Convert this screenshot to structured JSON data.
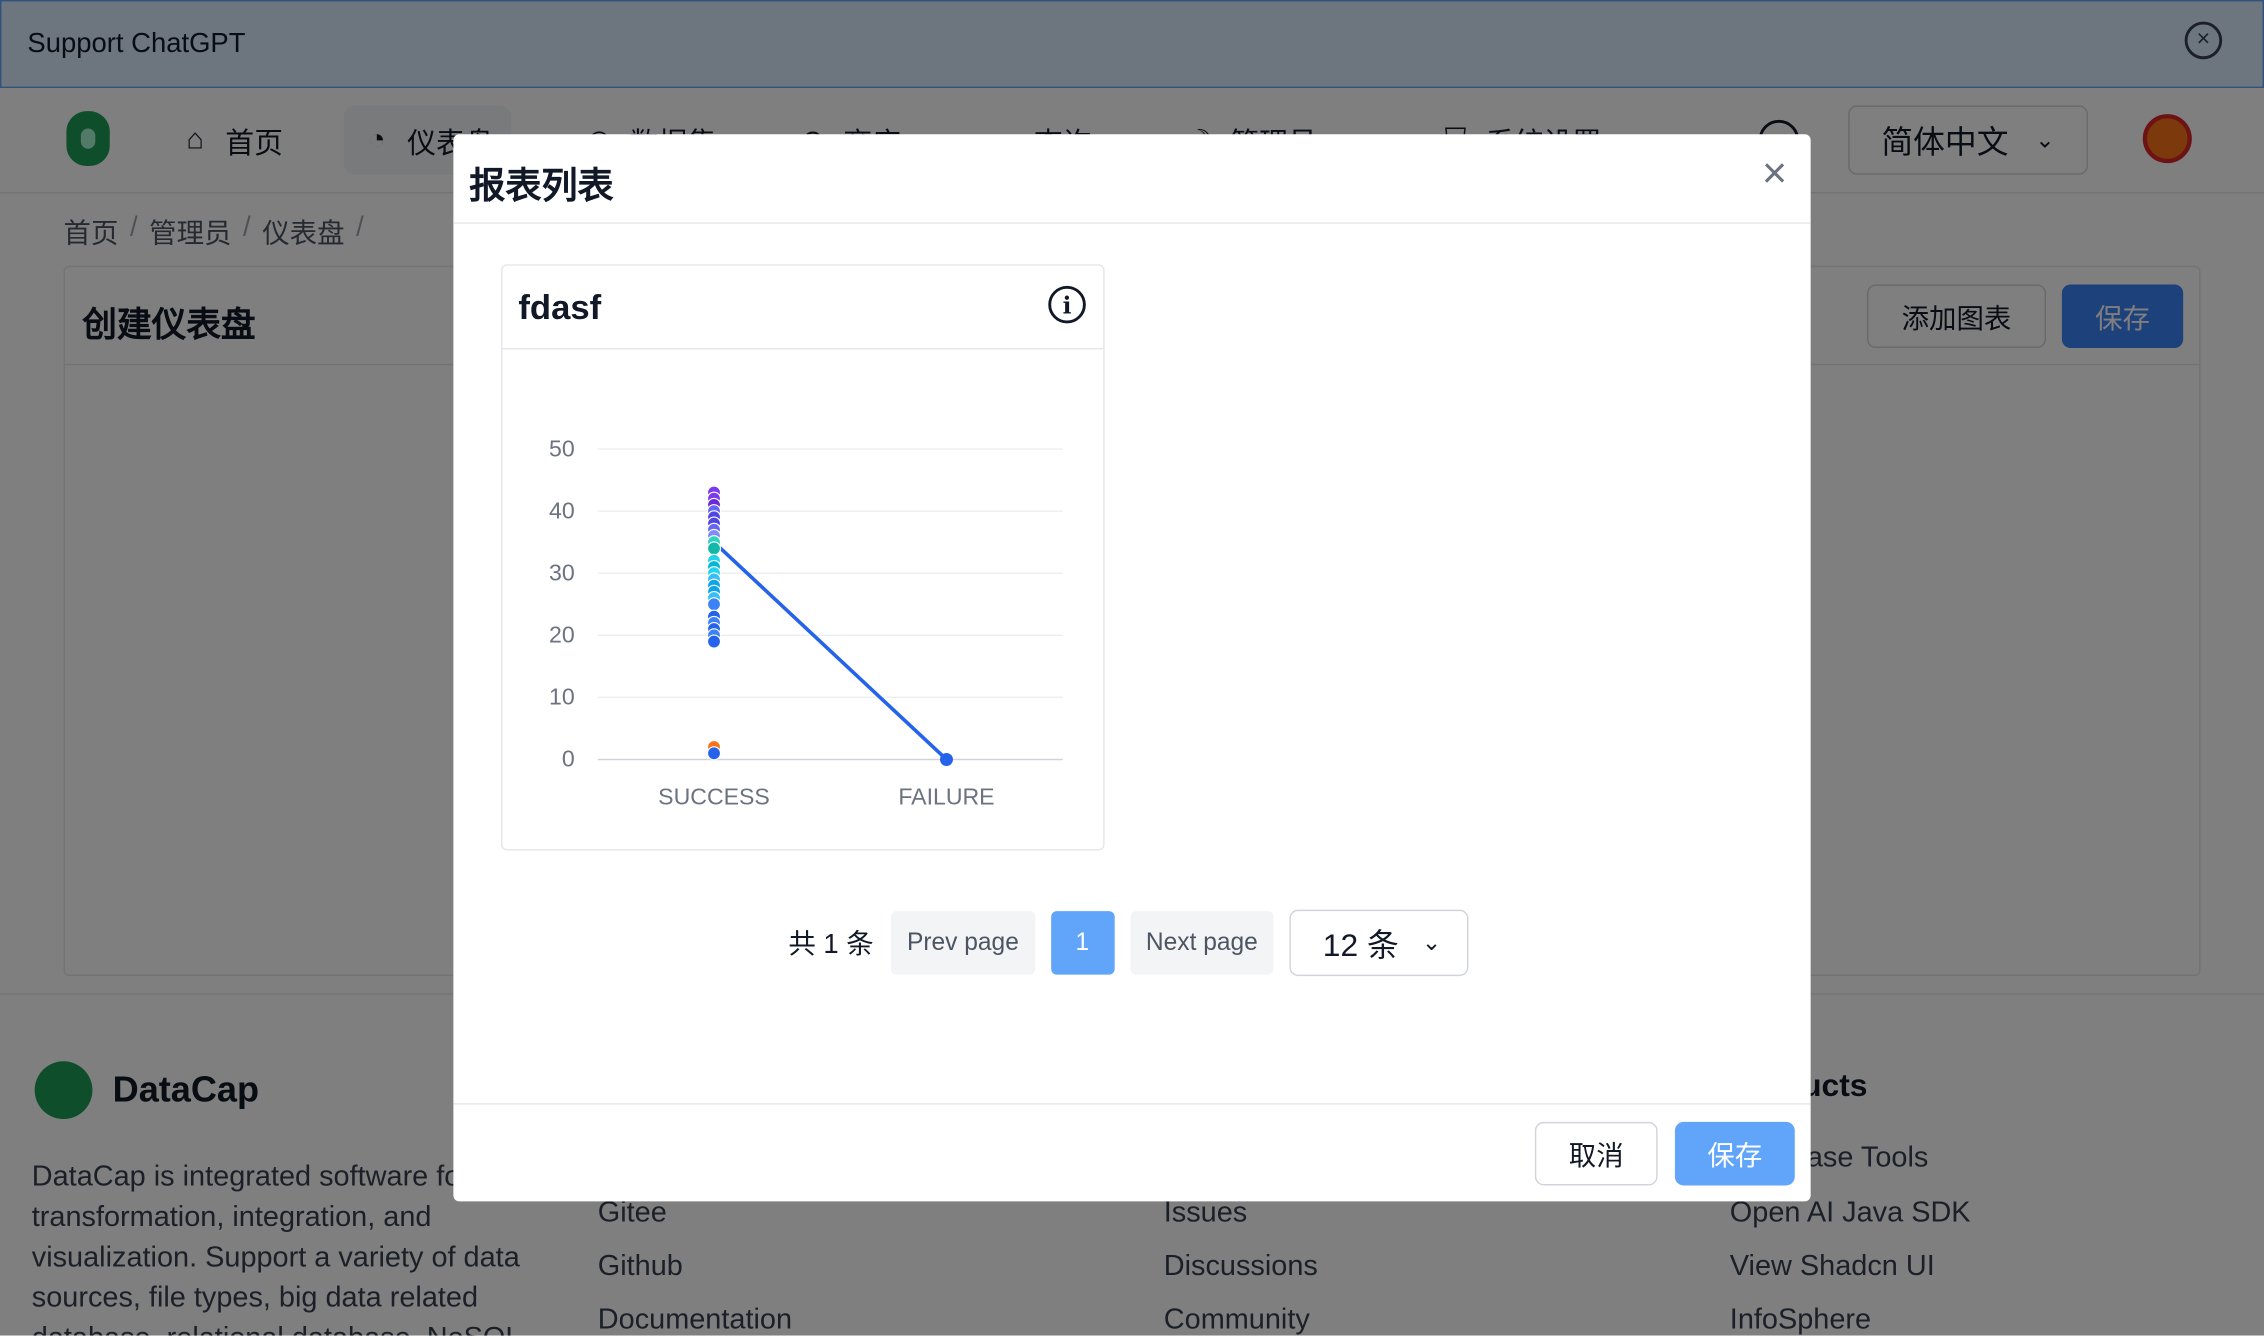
{
  "banner": {
    "text": "Support ChatGPT"
  },
  "nav": {
    "items": [
      {
        "label": "首页",
        "icon": "home-icon"
      },
      {
        "label": "仪表盘",
        "icon": "dashboard-icon"
      },
      {
        "label": "数据集",
        "icon": "dataset-icon"
      },
      {
        "label": "商店",
        "icon": "store-icon"
      },
      {
        "label": "查询",
        "icon": "query-icon"
      },
      {
        "label": "管理员",
        "icon": "admin-icon"
      },
      {
        "label": "系统设置",
        "icon": "settings-icon"
      }
    ],
    "language": "简体中文"
  },
  "breadcrumb": [
    "首页",
    "管理员",
    "仪表盘"
  ],
  "dashboard": {
    "title": "创建仪表盘",
    "add_chart_label": "添加图表",
    "save_label": "保存"
  },
  "footer": {
    "brand": "DataCap",
    "description": "DataCap is integrated software for data transformation, integration, and visualization. Support a variety of data sources, file types, big data related database, relational database, NoSQL",
    "col2": [
      "Gitee",
      "Github",
      "Documentation"
    ],
    "col3": [
      "Issues",
      "Discussions",
      "Community"
    ],
    "col4_head": "Products",
    "col4": [
      "Database Tools",
      "Open AI Java SDK",
      "View Shadcn UI",
      "InfoSphere"
    ]
  },
  "modal": {
    "title": "报表列表",
    "card_title": "fdasf",
    "pager": {
      "total": "共 1 条",
      "prev": "Prev page",
      "current": "1",
      "next": "Next page",
      "page_size": "12 条"
    },
    "cancel_label": "取消",
    "save_label": "保存"
  },
  "colors": {
    "primary": "#60a5fa",
    "primary_dark": "#3b82f6",
    "line": "#2563eb"
  },
  "chart_data": {
    "type": "scatter",
    "categories": [
      "SUCCESS",
      "FAILURE"
    ],
    "ylim": [
      0,
      50
    ],
    "yticks": [
      0,
      10,
      20,
      30,
      40,
      50
    ],
    "grid": true,
    "line_series": {
      "values": [
        35,
        0
      ]
    },
    "success_points": [
      {
        "y": 43,
        "color": "#7c3aed"
      },
      {
        "y": 42,
        "color": "#7c3aed"
      },
      {
        "y": 41,
        "color": "#6d28d9"
      },
      {
        "y": 40,
        "color": "#6366f1"
      },
      {
        "y": 39,
        "color": "#4f46e5"
      },
      {
        "y": 38,
        "color": "#4f46e5"
      },
      {
        "y": 37,
        "color": "#6366f1"
      },
      {
        "y": 36,
        "color": "#818cf8"
      },
      {
        "y": 35,
        "color": "#2dd4bf"
      },
      {
        "y": 34,
        "color": "#14b8a6"
      },
      {
        "y": 32,
        "color": "#22d3ee"
      },
      {
        "y": 31,
        "color": "#06b6d4"
      },
      {
        "y": 30,
        "color": "#22d3ee"
      },
      {
        "y": 29,
        "color": "#38bdf8"
      },
      {
        "y": 28,
        "color": "#0ea5e9"
      },
      {
        "y": 27,
        "color": "#0ea5e9"
      },
      {
        "y": 26,
        "color": "#38bdf8"
      },
      {
        "y": 25,
        "color": "#3b82f6"
      },
      {
        "y": 23,
        "color": "#2563eb"
      },
      {
        "y": 22,
        "color": "#3b82f6"
      },
      {
        "y": 21,
        "color": "#2563eb"
      },
      {
        "y": 20,
        "color": "#3b82f6"
      },
      {
        "y": 19,
        "color": "#2563eb"
      },
      {
        "y": 2,
        "color": "#f97316"
      },
      {
        "y": 1,
        "color": "#2563eb"
      }
    ]
  }
}
